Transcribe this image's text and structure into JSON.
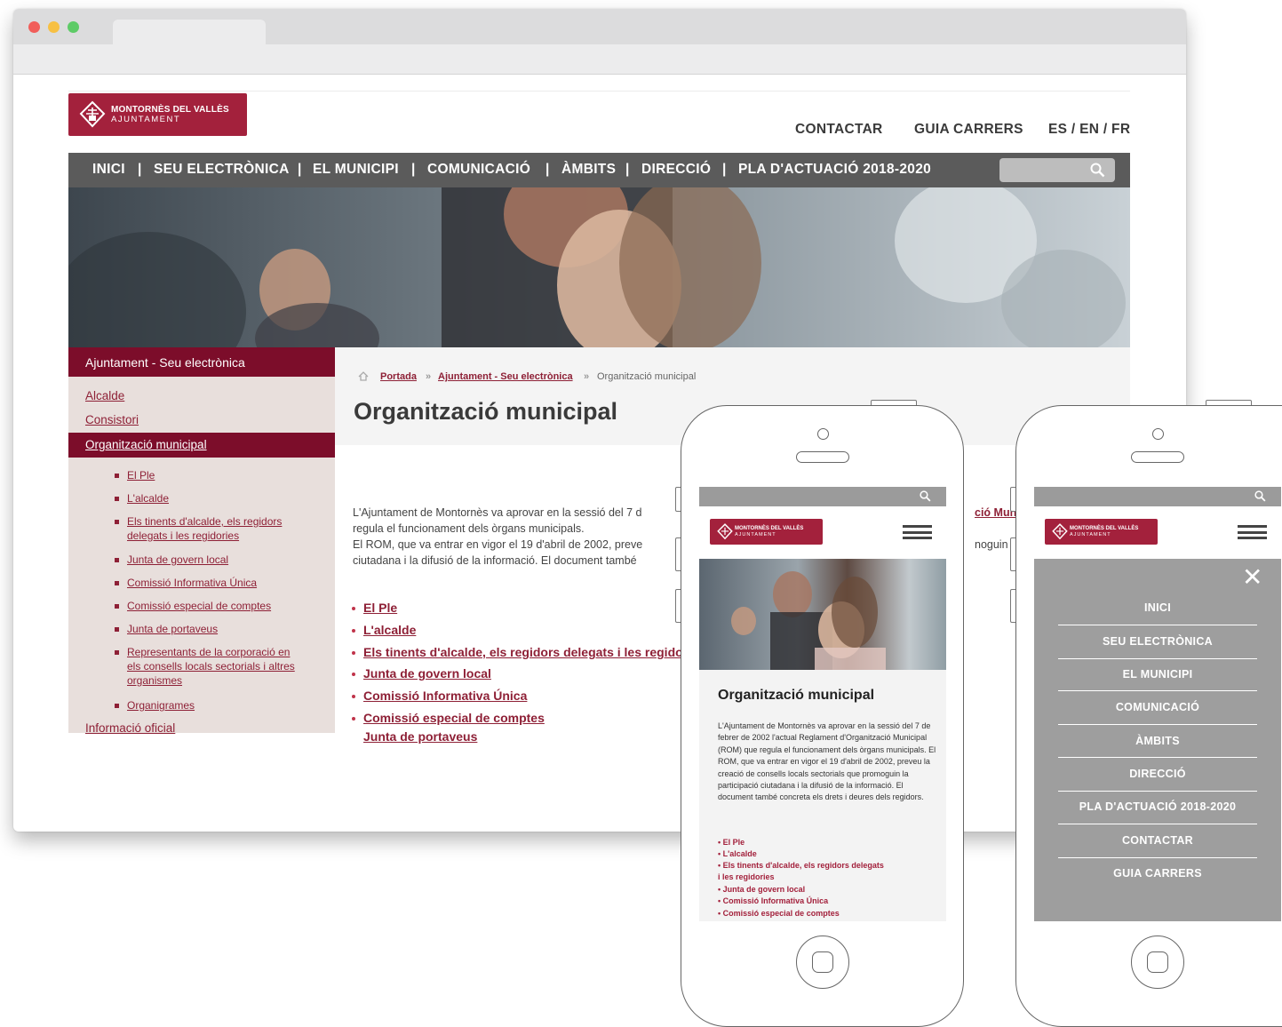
{
  "desktop": {
    "logo": {
      "line1": "MONTORNÈS DEL VALLÈS",
      "line2": "AJUNTAMENT"
    },
    "top_links": [
      "CONTACTAR",
      "GUIA CARRERS",
      "ES / EN / FR"
    ],
    "nav": [
      "INICI",
      "|",
      "SEU ELECTRÒNICA",
      "|",
      "EL MUNICIPI",
      "|",
      "COMUNICACIÓ",
      "|",
      "ÀMBITS",
      "|",
      "DIRECCIÓ",
      "|",
      "PLA D'ACTUACIÓ  2018-2020"
    ],
    "sidebar": {
      "header": "Ajuntament - Seu electrònica",
      "items": [
        "Alcalde",
        "Consistori",
        "Organització municipal"
      ],
      "subitems": [
        "El Ple",
        "L'alcalde",
        "Els tinents d'alcalde, els regidors",
        "delegats i les regidories",
        "Junta de govern local",
        "Comissió Informativa Única",
        "Comissió especial de comptes",
        "Junta de portaveus",
        "Representants de la corporació en",
        "els consells locals sectorials i altres",
        "organismes",
        "Organigrames"
      ],
      "cut_item": "Informació oficial"
    },
    "breadcrumb": {
      "home": "Portada",
      "sep": "»",
      "level1": "Ajuntament - Seu electrònica",
      "current": "Organització municipal"
    },
    "title": "Organització municipal",
    "paragraph": [
      "L'Ajuntament de Montornès va aprovar en la sessió del 7 d",
      "regula el funcionament dels òrgans municipals.",
      "El ROM, que va entrar en vigor el 19 d'abril de 2002, preve",
      "ciutadana i la difusió de la informació. El document també"
    ],
    "right_fragments": [
      "ció Muni",
      "noguin la"
    ],
    "links": [
      "El Ple",
      "L'alcalde",
      "Els tinents d'alcalde, els regidors delegats i les regidori",
      "Junta de govern local",
      "Comissió Informativa Única",
      "Comissió especial de comptes",
      "Junta de portaveus"
    ]
  },
  "phone1": {
    "logo": {
      "line1": "MONTORNÈS DEL VALLÈS",
      "line2": "AJUNTAMENT"
    },
    "title": "Organització municipal",
    "paragraph": "L'Ajuntament de Montornès va aprovar en la sessió del 7 de febrer de 2002 l'actual Reglament d'Organització Municipal (ROM) que regula el funcionament dels òrgans municipals. El ROM, que va entrar en vigor el 19 d'abril de 2002, preveu la creació de consells locals sectorials que promoguin la participació ciutadana i la difusió de la informació. El document també concreta els drets i deures dels regidors.",
    "links": [
      "• El Ple",
      "• L'alcalde",
      "• Els tinents d'alcalde, els regidors delegats",
      "i les regidories",
      "• Junta de govern local",
      "• Comissió Informativa Única",
      "• Comissió especial de comptes"
    ]
  },
  "phone2": {
    "logo": {
      "line1": "MONTORNÈS DEL VALLÈS",
      "line2": "AJUNTAMENT"
    },
    "close": "✕",
    "menu": [
      "INICI",
      "SEU ELECTRÒNICA",
      "EL MUNICIPI",
      "COMUNICACIÓ",
      "ÀMBITS",
      "DIRECCIÓ",
      "PLA D'ACTUACIÓ  2018-2020",
      "CONTACTAR",
      "GUIA CARRERS"
    ]
  },
  "colors": {
    "brand": "#a3213c",
    "sidebar_dark": "#7c0d2a",
    "nav": "#5b5b5b"
  },
  "icons": [
    "search-icon",
    "home-icon",
    "hamburger-icon",
    "close-icon",
    "municipal-crest-icon"
  ]
}
